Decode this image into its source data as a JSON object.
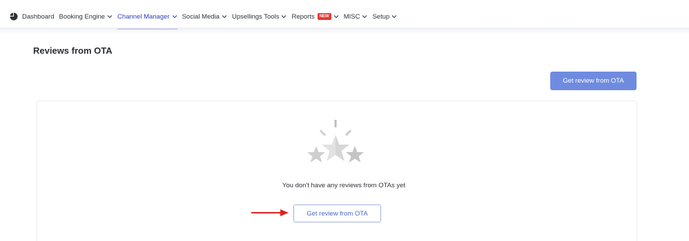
{
  "nav": {
    "items": [
      {
        "label": "Dashboard",
        "has_chevron": false
      },
      {
        "label": "Booking Engine",
        "has_chevron": true
      },
      {
        "label": "Channel Manager",
        "has_chevron": true,
        "active": true
      },
      {
        "label": "Social Media",
        "has_chevron": true
      },
      {
        "label": "Upsellings Tools",
        "has_chevron": true
      },
      {
        "label": "Reports",
        "has_chevron": true,
        "badge": "NEW"
      },
      {
        "label": "MISC",
        "has_chevron": true
      },
      {
        "label": "Setup",
        "has_chevron": true
      }
    ],
    "active_color": "#3546c9",
    "badge_color": "#e53935"
  },
  "page": {
    "title": "Reviews from OTA"
  },
  "actions": {
    "top_button_label": "Get review from OTA",
    "top_button_color": "#6f8be0"
  },
  "empty_state": {
    "illustration": "stars-icon",
    "message": "You don't have any reviews from OTAs yet",
    "button_label": "Get review from OTA"
  },
  "annotation": {
    "arrow_color": "#e02020"
  }
}
